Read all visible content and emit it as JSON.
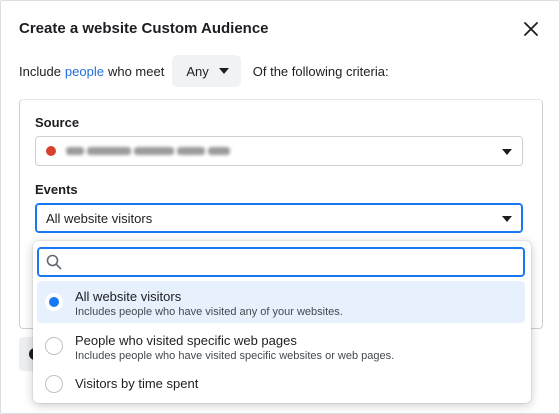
{
  "dialog": {
    "title": "Create a website Custom Audience"
  },
  "include_row": {
    "prefix": "Include",
    "link": "people",
    "middle": "who meet",
    "any_label": "Any",
    "suffix": "Of the following criteria:"
  },
  "source": {
    "label": "Source",
    "status_color": "#d8422c"
  },
  "events": {
    "label": "Events",
    "selected": "All website visitors"
  },
  "dropdown": {
    "search_placeholder": "",
    "options": [
      {
        "title": "All website visitors",
        "description": "Includes people who have visited any of your websites.",
        "selected": true
      },
      {
        "title": "People who visited specific web pages",
        "description": "Includes people who have visited specific websites or web pages.",
        "selected": false
      },
      {
        "title": "Visitors by time spent",
        "description": "",
        "selected": false
      }
    ]
  },
  "colors": {
    "accent": "#1877f2",
    "link": "#216fdb",
    "selected_bg": "#e7f0fd"
  },
  "icons": {
    "close": "close-icon",
    "search": "search-icon",
    "dropdown": "caret-down-icon"
  }
}
